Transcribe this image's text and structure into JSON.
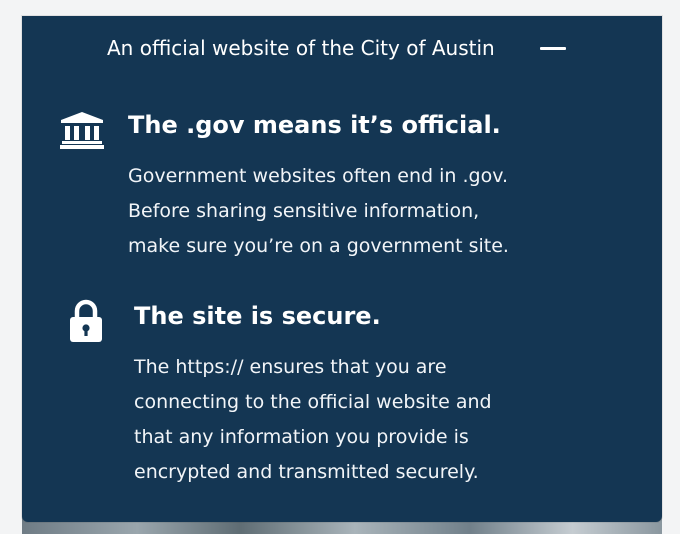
{
  "banner": {
    "text": "An official website of the City of Austin"
  },
  "items": [
    {
      "icon": "government-building-icon",
      "title": "The .gov means it’s official.",
      "lines": [
        "Government websites often end in .gov.",
        "Before sharing sensitive information,",
        "make sure you’re on a government site."
      ]
    },
    {
      "icon": "lock-icon",
      "title": "The site is secure.",
      "lines": [
        "The https:// ensures that you are",
        "connecting to the official website and",
        "that any information you provide is",
        "encrypted and transmitted securely."
      ]
    }
  ],
  "colors": {
    "panel_bg": "#143653",
    "text": "#ffffff"
  }
}
